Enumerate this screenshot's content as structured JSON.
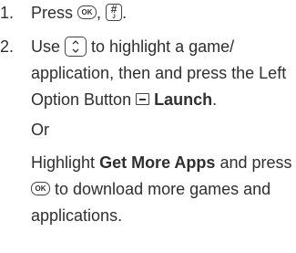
{
  "steps": [
    {
      "number": "1.",
      "text_before": "Press",
      "key1": "OK",
      "comma": ",",
      "key2_top": "#",
      "key2_bottom": "J",
      "period": "."
    },
    {
      "number": "2.",
      "line1_a": "Use",
      "line1_b": "to highlight a game/",
      "line2": "application, then and press the Left",
      "line3_a": "Option Button",
      "line3_bold": "Launch",
      "line3_end": ".",
      "or": "Or",
      "line5_a": "Highlight",
      "line5_bold": "Get More Apps",
      "line5_b": "and press",
      "line6_key": "OK",
      "line6_b": "to download more games and",
      "line7": "applications."
    }
  ],
  "icons": {
    "ok_key": "ok-key-icon",
    "pound_key": "pound-key-icon",
    "nav_key": "navigation-key-icon",
    "left_soft_key": "left-soft-key-icon"
  }
}
